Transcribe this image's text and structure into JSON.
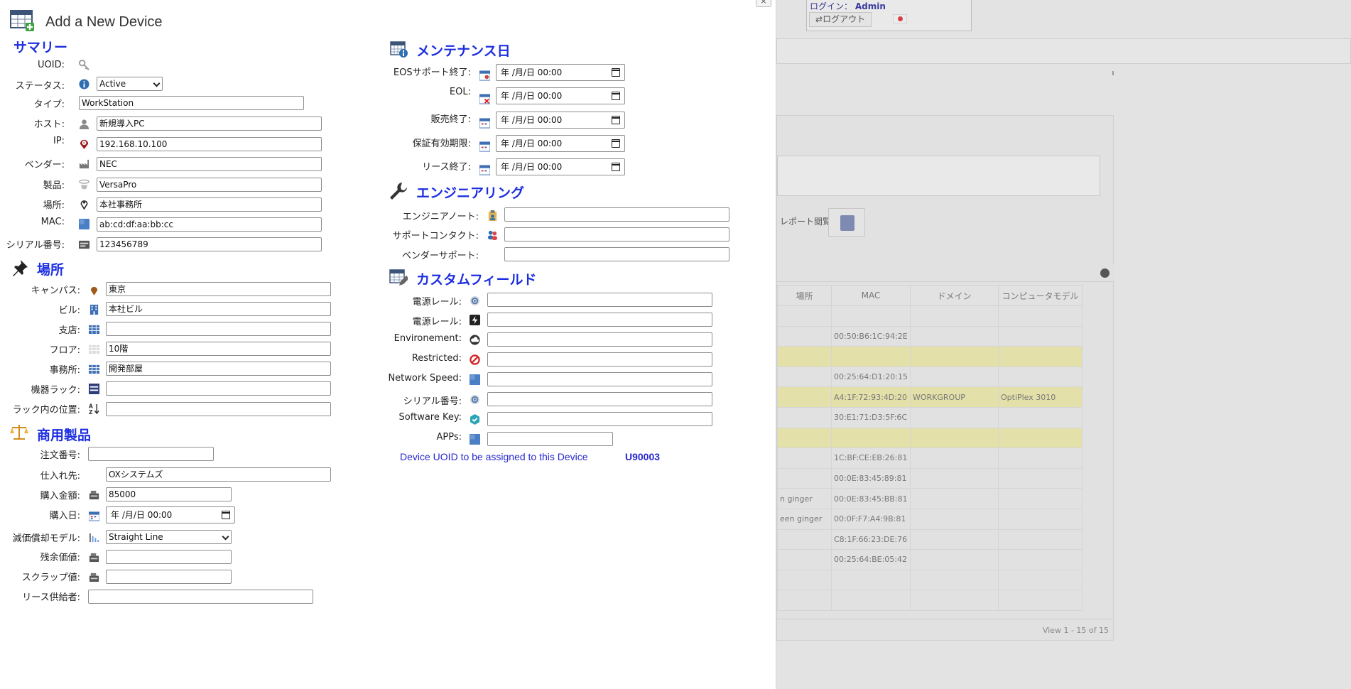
{
  "background": {
    "login_label": "ログイン：",
    "login_user": "Admin",
    "logout_label": "ログアウト",
    "report_label": "レポート閲覧",
    "columns": [
      "場所",
      "MAC",
      "ドメイン",
      "コンピュータモデル"
    ],
    "rows": [
      {
        "place": "",
        "mac": "",
        "domain": "",
        "model": "",
        "hl": false
      },
      {
        "place": "",
        "mac": "00:50:B6:1C:94:2E",
        "domain": "",
        "model": "",
        "hl": false
      },
      {
        "place": "",
        "mac": "",
        "domain": "",
        "model": "",
        "hl": true
      },
      {
        "place": "",
        "mac": "00:25:64:D1:20:15",
        "domain": "",
        "model": "",
        "hl": false
      },
      {
        "place": "",
        "mac": "A4:1F:72:93:4D:20",
        "domain": "WORKGROUP",
        "model": "OptiPlex 3010",
        "hl": true
      },
      {
        "place": "",
        "mac": "30:E1:71:D3:5F:6C",
        "domain": "",
        "model": "",
        "hl": false
      },
      {
        "place": "",
        "mac": "",
        "domain": "",
        "model": "",
        "hl": true
      },
      {
        "place": "",
        "mac": "1C:BF:CE:EB:26:81",
        "domain": "",
        "model": "",
        "hl": false
      },
      {
        "place": "",
        "mac": "00:0E:83:45:89:81",
        "domain": "",
        "model": "",
        "hl": false
      },
      {
        "place": "n ginger",
        "mac": "00:0E:83:45:BB:81",
        "domain": "",
        "model": "",
        "hl": false
      },
      {
        "place": "een ginger",
        "mac": "00:0F:F7:A4:9B:81",
        "domain": "",
        "model": "",
        "hl": false
      },
      {
        "place": "",
        "mac": "C8:1F:66:23:DE:76",
        "domain": "",
        "model": "",
        "hl": false
      },
      {
        "place": "",
        "mac": "00:25:64:BE:05:42",
        "domain": "",
        "model": "",
        "hl": false
      },
      {
        "place": "",
        "mac": "",
        "domain": "",
        "model": "",
        "hl": false
      },
      {
        "place": "",
        "mac": "",
        "domain": "",
        "model": "",
        "hl": false
      }
    ],
    "pager": "View 1 - 15 of 15"
  },
  "dialog": {
    "title": "Add a New Device",
    "close_label": "×",
    "sections": {
      "summary": "サマリー",
      "location": "場所",
      "commercial": "商用製品",
      "maintenance": "メンテナンス日",
      "engineering": "エンジニアリング",
      "custom": "カスタムフィールド"
    },
    "summary": {
      "uoid_label": "UOID:",
      "status_label": "ステータス:",
      "status_value": "Active",
      "type_label": "タイプ:",
      "type_value": "WorkStation",
      "host_label": "ホスト:",
      "host_value": "新規導入PC",
      "ip_label": "IP:",
      "ip_value": "192.168.10.100",
      "vendor_label": "ベンダー:",
      "vendor_value": "NEC",
      "product_label": "製品:",
      "product_value": "VersaPro",
      "place_label": "場所:",
      "place_value": "本社事務所",
      "mac_label": "MAC:",
      "mac_value": "ab:cd:df:aa:bb:cc",
      "serial_label": "シリアル番号:",
      "serial_value": "123456789"
    },
    "location": {
      "campus_label": "キャンパス:",
      "campus_value": "東京",
      "building_label": "ビル:",
      "building_value": "本社ビル",
      "branch_label": "支店:",
      "branch_value": "",
      "floor_label": "フロア:",
      "floor_value": "10階",
      "office_label": "事務所:",
      "office_value": "開発部屋",
      "rack_label": "機器ラック:",
      "rack_value": "",
      "rackpos_label": "ラック内の位置:",
      "rackpos_value": ""
    },
    "commercial": {
      "order_label": "注文番号:",
      "order_value": "",
      "supplier_label": "仕入れ先:",
      "supplier_value": "OXシステムズ",
      "price_label": "購入金額:",
      "price_value": "85000",
      "purchase_label": "購入日:",
      "purchase_value": "年 /月/日 00:00",
      "depr_label": "減価償却モデル:",
      "depr_value": "Straight Line",
      "residual_label": "残余価値:",
      "residual_value": "",
      "scrap_label": "スクラップ値:",
      "scrap_value": "",
      "lease_label": "リース供給者:",
      "lease_value": ""
    },
    "maintenance": {
      "eos_label": "EOSサポート終了:",
      "eol_label": "EOL:",
      "eosale_label": "販売終了:",
      "warranty_label": "保証有効期限:",
      "leaseend_label": "リース終了:",
      "date_placeholder": "年 /月/日 00:00"
    },
    "engineering": {
      "note_label": "エンジニアノート:",
      "contact_label": "サポートコンタクト:",
      "vendor_support_label": "ベンダーサポート:"
    },
    "custom": {
      "power1_label": "電源レール:",
      "power2_label": "電源レール:",
      "env_label": "Environement:",
      "restricted_label": "Restricted:",
      "netspeed_label": "Network Speed:",
      "serial_label": "シリアル番号:",
      "swkey_label": "Software Key:",
      "apps_label": "APPs:"
    },
    "uoid_note": "Device UOID to be assigned to this Device",
    "uoid_value": "U90003"
  }
}
